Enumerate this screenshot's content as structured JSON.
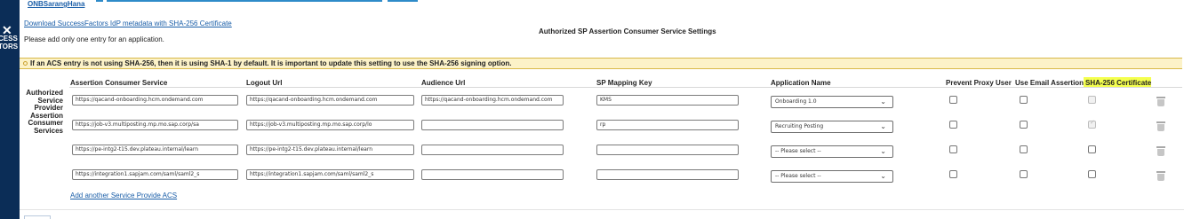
{
  "org": {
    "name": "ONBSarangHana"
  },
  "brand": {
    "line1": "CESS",
    "line2": "TORS"
  },
  "download_link": "Download SuccessFactors IdP metadata with SHA-256 Certificate",
  "note": "Please add only one entry for an application.",
  "heading": "Authorized SP Assertion Consumer Service Settings",
  "banner": "If an ACS entry is not using SHA-256, then it is using SHA-1 by default. It is important to update this setting to use the SHA-256 signing option.",
  "section_title": {
    "l1": "Authorized",
    "l2": "Service",
    "l3": "Provider",
    "l4": "Assertion",
    "l5": "Consumer",
    "l6": "Services"
  },
  "columns": {
    "acs": "Assertion Consumer Service",
    "logout": "Logout Url",
    "audience": "Audience Url",
    "sp": "SP Mapping Key",
    "app": "Application Name",
    "proxy": "Prevent Proxy User",
    "email": "Use Email Assertion",
    "sha": "SHA-256 Certificate"
  },
  "rows": [
    {
      "acs": "https://qacand-onboarding.hcm.ondemand.com",
      "logout": "https://qacand-onboarding.hcm.ondemand.com",
      "audience": "https://qacand-onboarding.hcm.ondemand.com",
      "sp": "KMS",
      "app": "Onboarding 1.0",
      "sha_checked": false
    },
    {
      "acs": "https://job-v3.multiposting.mp.mo.sap.corp/sa",
      "logout": "https://job-v3.multiposting.mp.mo.sap.corp/lo",
      "audience": "",
      "sp": "rp",
      "app": "Recruiting Posting",
      "sha_checked": true
    },
    {
      "acs": "https://pe-intg2-t15.dev.plateau.internal/learn",
      "logout": "https://pe-intg2-t15.dev.plateau.internal/learn",
      "audience": "",
      "sp": "",
      "app": "-- Please select --",
      "sha_checked": true
    },
    {
      "acs": "https://integration1.sapjam.com/saml/saml2_s",
      "logout": "https://integration1.sapjam.com/saml/saml2_s",
      "audience": "",
      "sp": "",
      "app": "-- Please select --",
      "sha_checked": false
    }
  ],
  "add_link": "Add another Service Provide ACS",
  "colors": {
    "highlight": "#f4ff4e",
    "banner_bg": "#fcf2c8",
    "link": "#1a5ea8",
    "sidebar": "#0b2d57"
  },
  "icons": {
    "warning": "warning-icon",
    "chevron": "chevron-down-icon",
    "delete": "trash-icon"
  }
}
